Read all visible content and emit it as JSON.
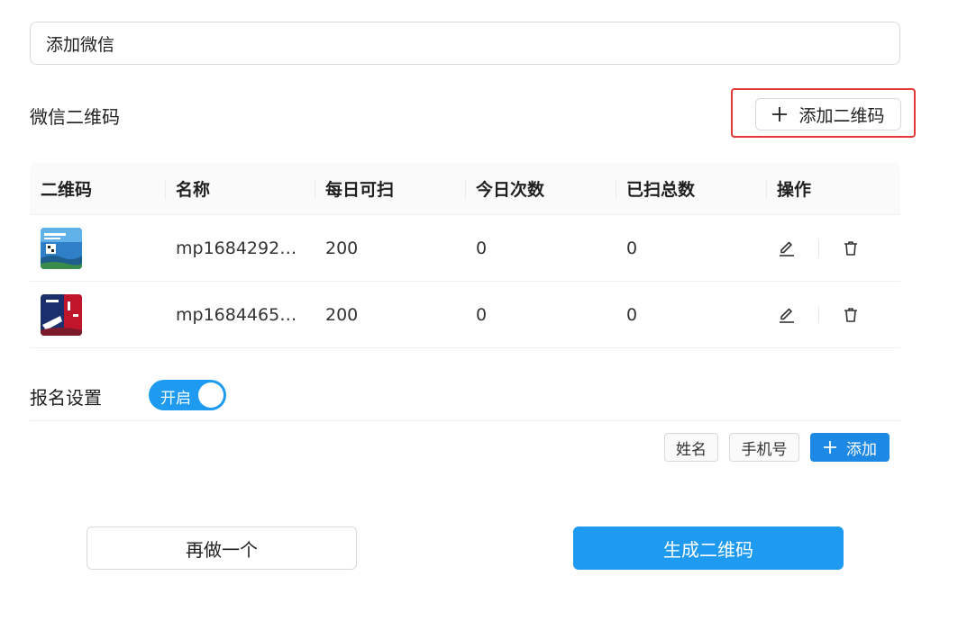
{
  "form": {
    "title_value": "添加微信"
  },
  "qr_section": {
    "label": "微信二维码",
    "add_button_label": "添加二维码"
  },
  "table": {
    "headers": [
      "二维码",
      "名称",
      "每日可扫",
      "今日次数",
      "已扫总数",
      "操作"
    ],
    "rows": [
      {
        "name": "mp16842920...",
        "daily_limit": "200",
        "today_count": "0",
        "total_scanned": "0"
      },
      {
        "name": "mp16844651...",
        "daily_limit": "200",
        "today_count": "0",
        "total_scanned": "0"
      }
    ],
    "row_actions": [
      "edit-icon",
      "trash-icon"
    ]
  },
  "signup": {
    "label": "报名设置",
    "toggle_label": "开启",
    "toggle_on": true,
    "fields": [
      "姓名",
      "手机号"
    ],
    "add_label": "添加"
  },
  "footer": {
    "redo_label": "再做一个",
    "generate_label": "生成二维码"
  },
  "colors": {
    "primary": "#1e9bf0",
    "highlight_border": "#e53935"
  }
}
